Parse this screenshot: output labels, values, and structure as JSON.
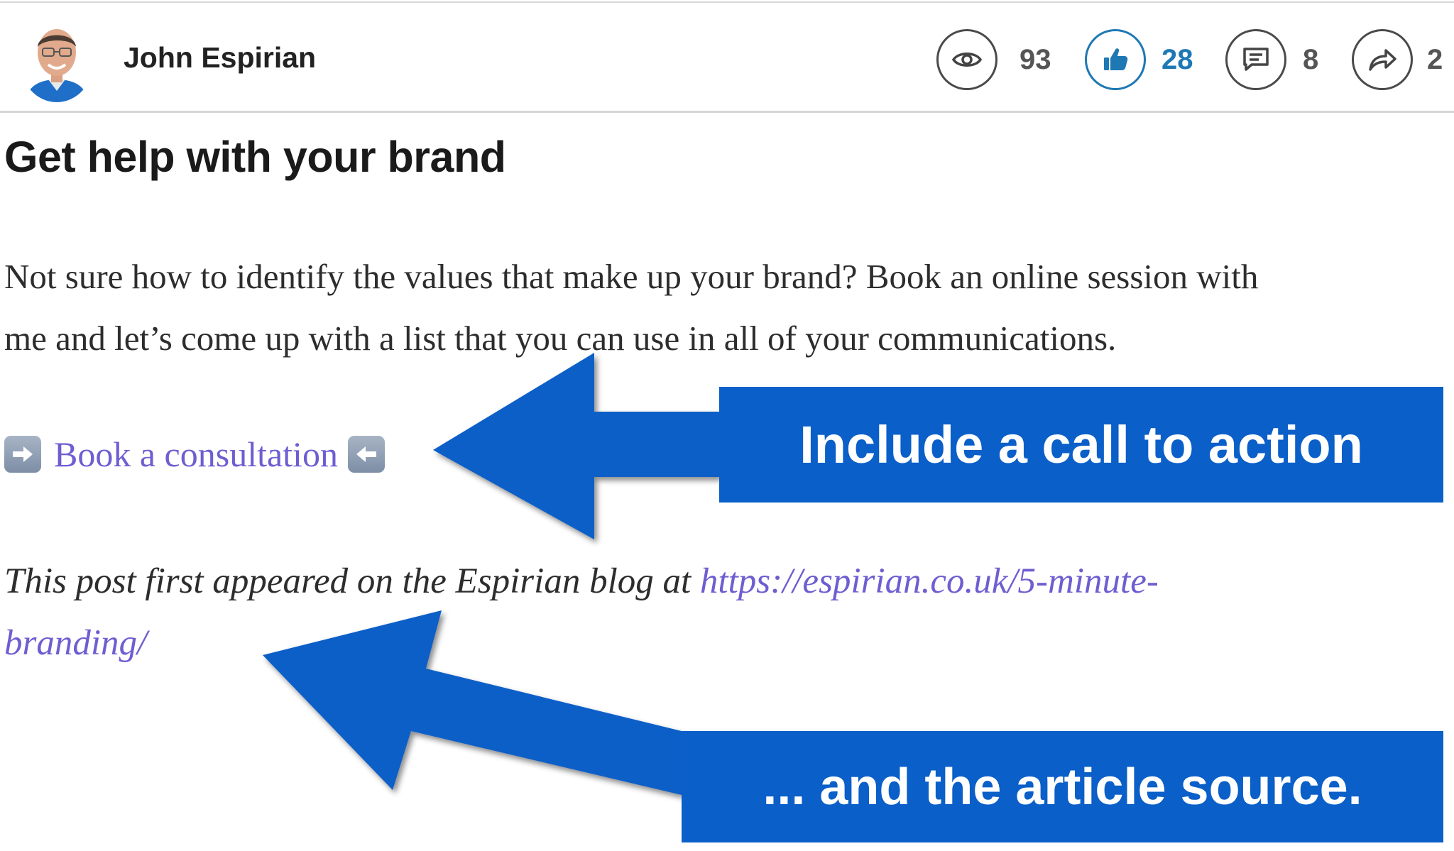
{
  "header": {
    "author_name": "John Espirian",
    "stats": {
      "views": "93",
      "likes": "28",
      "comments": "8",
      "shares": "2"
    },
    "icons": [
      "eye-icon",
      "thumbs-up-icon",
      "comment-icon",
      "share-icon"
    ]
  },
  "article": {
    "heading": "Get help with your brand",
    "paragraph_line1": "Not sure how to identify the values that make up your brand? Book an online session with",
    "paragraph_line2": "me and let’s come up with a list that you can use in all of your communications.",
    "cta_label": "Book a consultation",
    "source_prefix": "This post first appeared on the Espirian blog at ",
    "source_link_line1": "https://espirian.co.uk/5-minute-",
    "source_link_line2": "branding/"
  },
  "annotations": {
    "callout1": "Include a call to action",
    "callout2": "... and the article source."
  },
  "colors": {
    "accent_blue": "#1d78b4",
    "link_purple": "#6e5ed1",
    "callout_blue": "#0a5fc8"
  }
}
